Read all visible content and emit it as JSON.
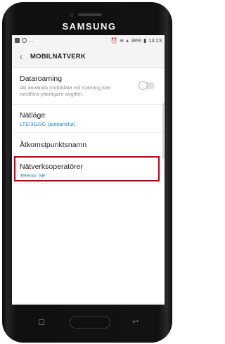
{
  "device": {
    "brand": "SAMSUNG"
  },
  "statusbar": {
    "left_icons": [
      "image-icon",
      "phone-icon",
      "ellipsis"
    ],
    "left_ellipsis": "...",
    "right_icons": [
      "alarm-icon",
      "wifi-icon",
      "signal-icon"
    ],
    "battery": "38%",
    "time": "13:23"
  },
  "appbar": {
    "title": "MOBILNÄTVERK"
  },
  "settings": [
    {
      "title": "Dataroaming",
      "subtitle": "Att använda mobildata vid roaming kan medföra ytterligare avgifter.",
      "toggle": false
    },
    {
      "title": "Nätläge",
      "value": "LTE/3G/2G (autoanslut)"
    },
    {
      "title": "Åtkomstpunktsnamn"
    },
    {
      "title": "Nätverksoperatörer",
      "value": "Telenor SE",
      "highlighted": true
    }
  ],
  "colors": {
    "accent": "#1e8fd6",
    "highlight": "#c00018"
  }
}
